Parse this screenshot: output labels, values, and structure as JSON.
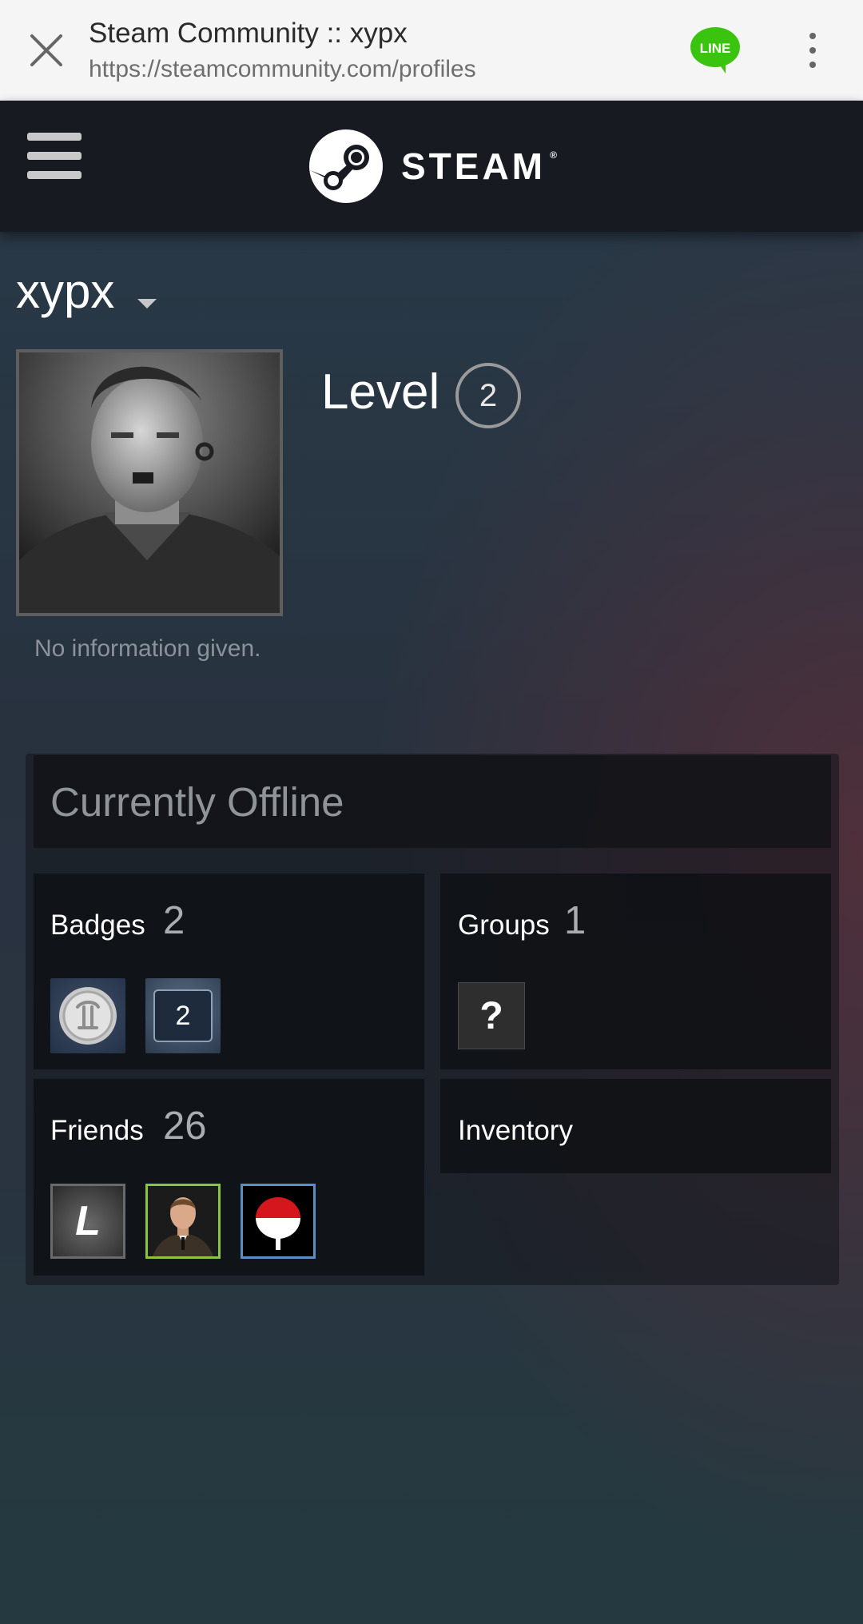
{
  "browser": {
    "title": "Steam Community :: xypx",
    "url": "https://steamcommunity.com/profiles",
    "line_badge": "LINE"
  },
  "header": {
    "brand": "STEAM",
    "registered_mark": "®"
  },
  "profile": {
    "persona_name": "xypx",
    "level_label": "Level",
    "level_value": "2",
    "summary": "No information given."
  },
  "status": {
    "text": "Currently Offline"
  },
  "tiles": {
    "badges": {
      "label": "Badges",
      "count": "2",
      "badge_level_text": "2"
    },
    "groups": {
      "label": "Groups",
      "count": "1",
      "placeholder": "?"
    },
    "friends": {
      "label": "Friends",
      "count": "26",
      "first_avatar_letter": "L"
    },
    "inventory": {
      "label": "Inventory"
    }
  },
  "colors": {
    "steam_header": "#171a21",
    "line_green": "#3ac30f",
    "friend_online_border": "#5c8ec2",
    "friend_ingame_border": "#8bc53f",
    "friend_offline_border": "#6a6a6a"
  }
}
